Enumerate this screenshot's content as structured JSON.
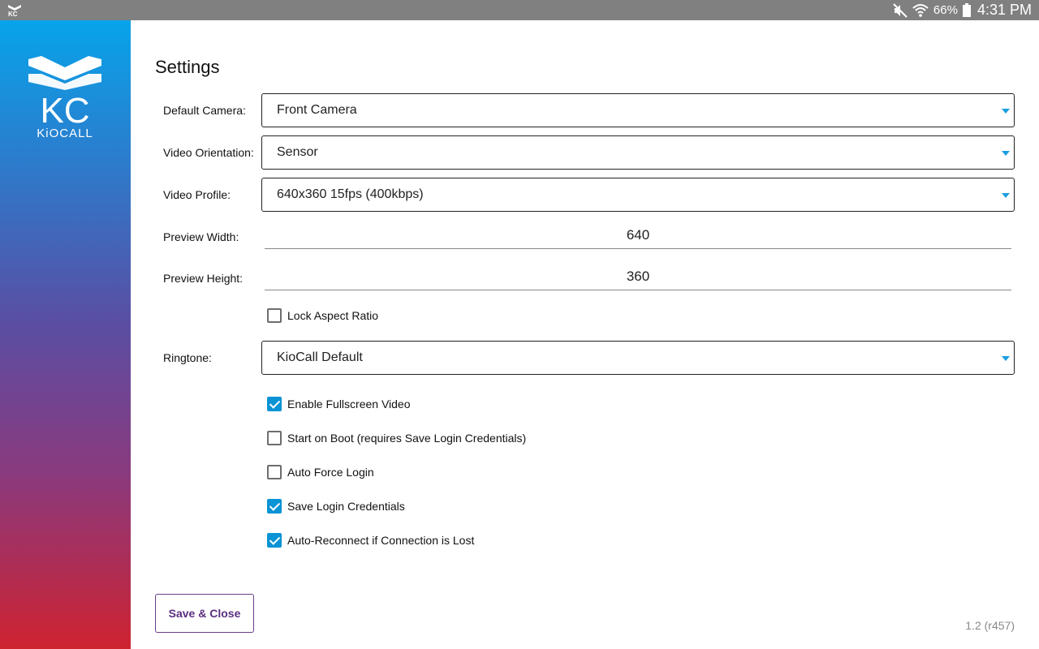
{
  "statusbar": {
    "battery_percent": "66%",
    "time": "4:31 PM",
    "icons": [
      "app-logo-icon",
      "mute-icon",
      "wifi-icon",
      "battery-icon"
    ]
  },
  "sidebar": {
    "logo_text": "KC",
    "logo_subtext": "KiOCALL"
  },
  "main": {
    "title": "Settings",
    "default_camera": {
      "label": "Default Camera:",
      "value": "Front Camera"
    },
    "video_orientation": {
      "label": "Video Orientation:",
      "value": "Sensor"
    },
    "video_profile": {
      "label": "Video Profile:",
      "value": "640x360 15fps (400kbps)"
    },
    "preview_width": {
      "label": "Preview Width:",
      "value": "640"
    },
    "preview_height": {
      "label": "Preview Height:",
      "value": "360"
    },
    "lock_aspect_ratio": {
      "label": "Lock Aspect Ratio",
      "checked": false
    },
    "ringtone": {
      "label": "Ringtone:",
      "value": "KioCall Default"
    },
    "options": [
      {
        "label": "Enable Fullscreen Video",
        "checked": true
      },
      {
        "label": "Start on Boot (requires Save Login Credentials)",
        "checked": false
      },
      {
        "label": "Auto Force Login",
        "checked": false
      },
      {
        "label": "Save Login Credentials",
        "checked": true
      },
      {
        "label": "Auto-Reconnect if Connection is Lost",
        "checked": true
      }
    ],
    "save_button_label": "Save & Close",
    "version": "1.2 (r457)"
  },
  "colors": {
    "accent": "#0a93d5",
    "button_text": "#5b2f80",
    "statusbar": "#808080"
  }
}
